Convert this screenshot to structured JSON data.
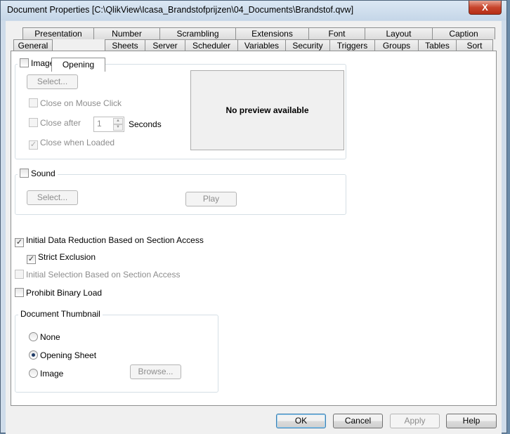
{
  "window": {
    "title": "Document Properties [C:\\QlikView\\Icasa_Brandstofprijzen\\04_Documents\\Brandstof.qvw]",
    "close_label": "X"
  },
  "tabs_row1": [
    "Presentation",
    "Number",
    "Scrambling",
    "Extensions",
    "Font",
    "Layout",
    "Caption"
  ],
  "tabs_row2": [
    "General",
    "Opening",
    "Sheets",
    "Server",
    "Scheduler",
    "Variables",
    "Security",
    "Triggers",
    "Groups",
    "Tables",
    "Sort"
  ],
  "active_tab": "Opening",
  "image_group": {
    "label": "Image",
    "checked": false,
    "select_label": "Select...",
    "close_on_click": "Close on Mouse Click",
    "close_after": "Close after",
    "close_after_value": "1",
    "seconds": "Seconds",
    "close_when_loaded": "Close when Loaded",
    "preview_text": "No preview available"
  },
  "sound_group": {
    "label": "Sound",
    "checked": false,
    "select_label": "Select...",
    "play_label": "Play"
  },
  "options": {
    "initial_reduction": "Initial Data Reduction Based on Section Access",
    "strict_exclusion": "Strict Exclusion",
    "initial_selection": "Initial Selection Based on Section Access",
    "prohibit_binary": "Prohibit Binary Load"
  },
  "thumbnail": {
    "label": "Document Thumbnail",
    "options": [
      "None",
      "Opening Sheet",
      "Image"
    ],
    "selected": "Opening Sheet",
    "browse_label": "Browse..."
  },
  "buttons": {
    "ok": "OK",
    "cancel": "Cancel",
    "apply": "Apply",
    "help": "Help"
  }
}
